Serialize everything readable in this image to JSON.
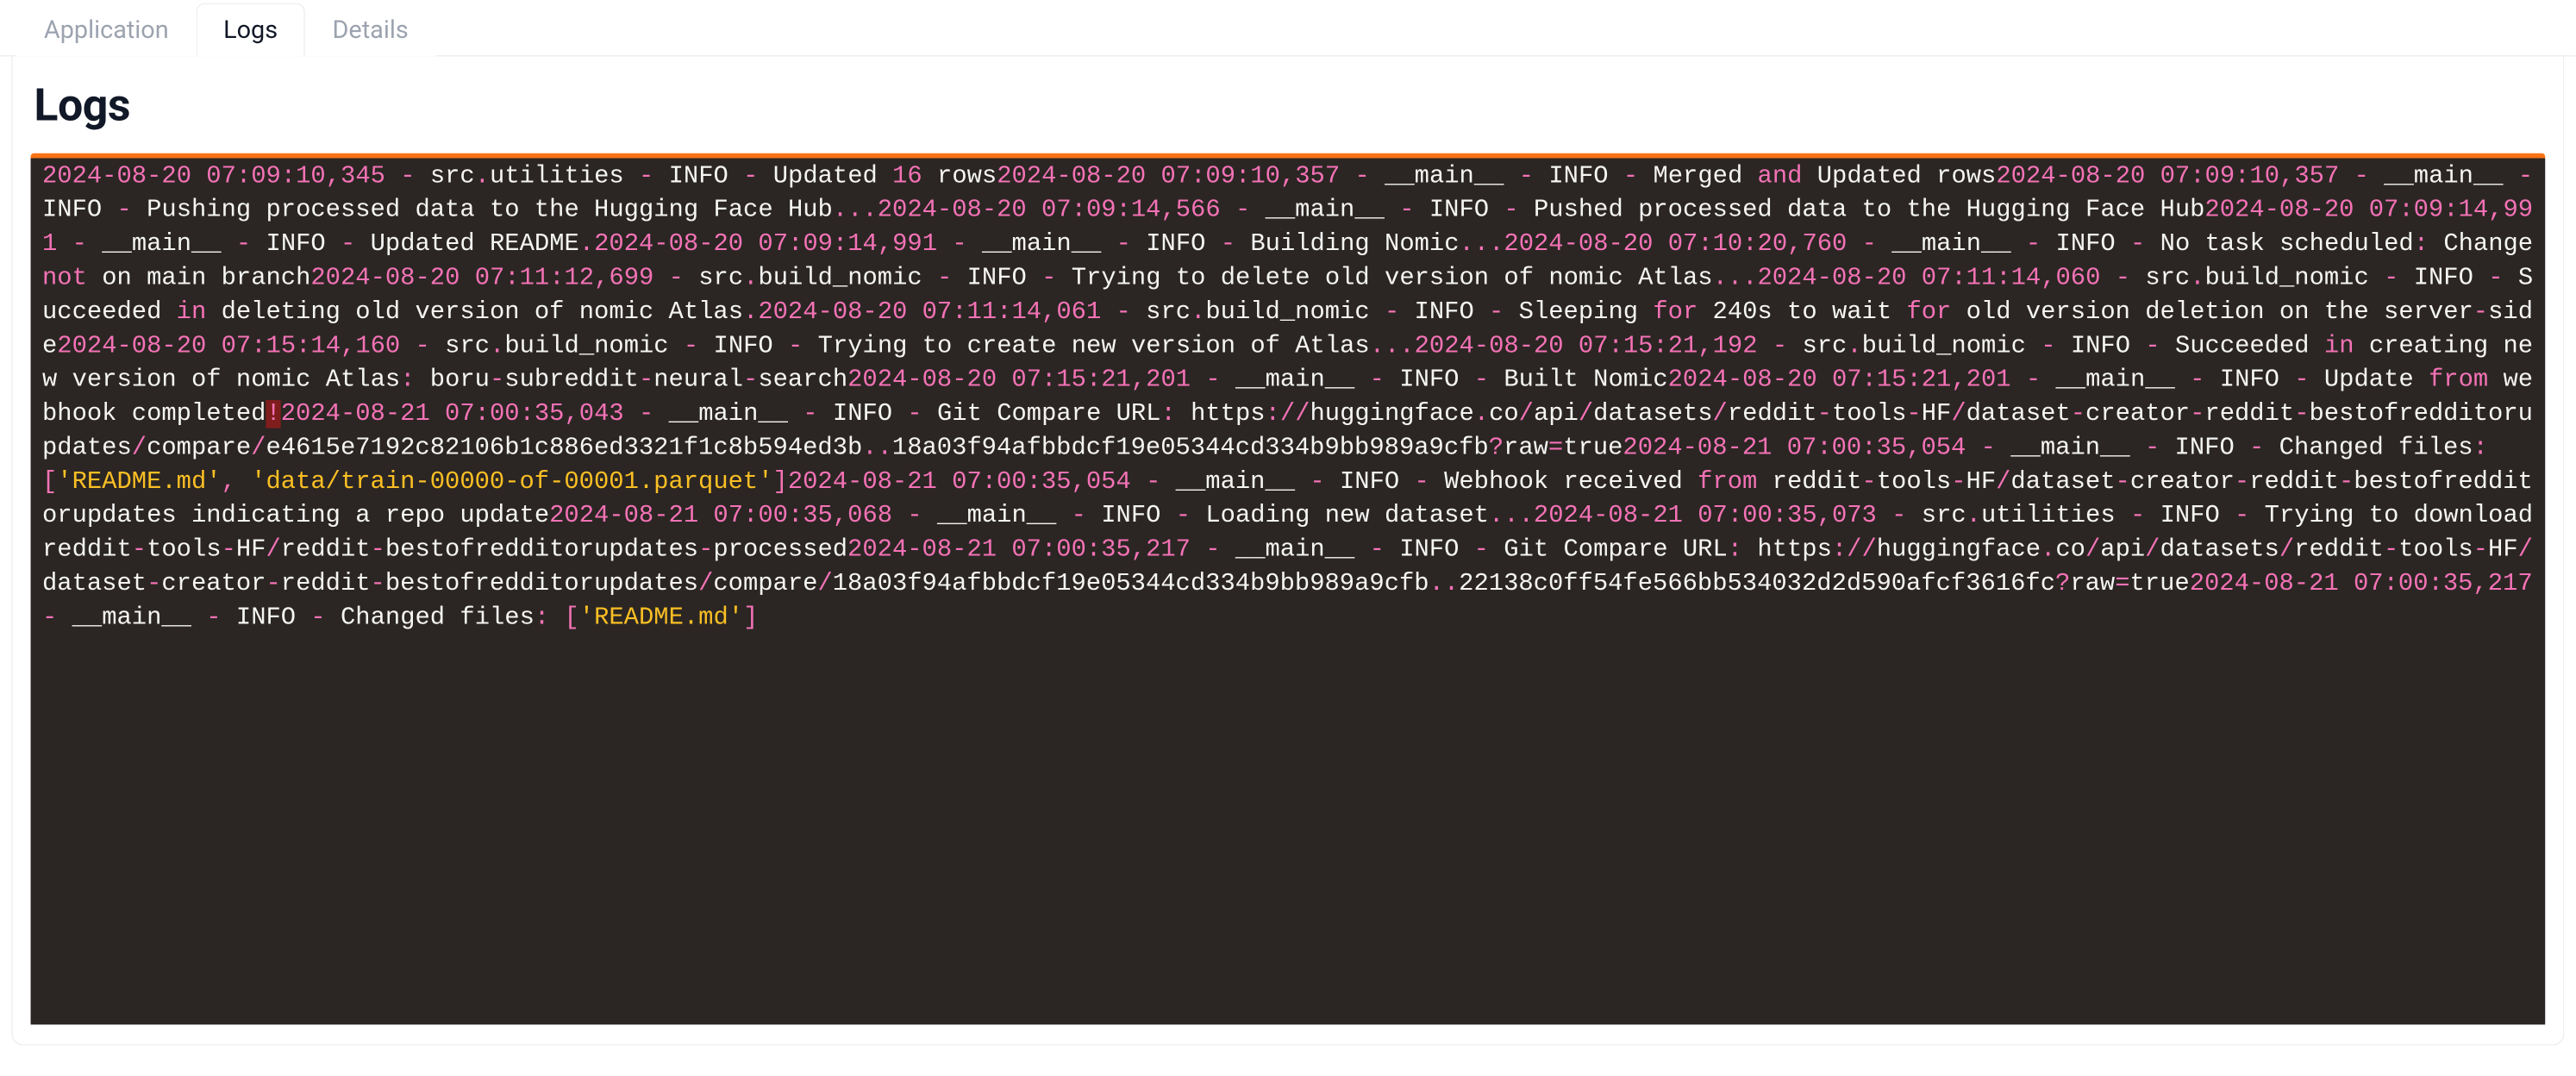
{
  "tabs": {
    "application": "Application",
    "logs": "Logs",
    "details": "Details",
    "active": "logs"
  },
  "panel": {
    "title": "Logs"
  },
  "log": {
    "highlight_keywords": [
      "and",
      "not",
      "in",
      "for",
      "from"
    ],
    "lines": [
      {
        "ts": "2024-08-20 07:09:10,345",
        "mod": "src.utilities",
        "lvl": "INFO",
        "msg": "Updated 16 rows"
      },
      {
        "ts": "2024-08-20 07:09:10,357",
        "mod": "__main__",
        "lvl": "INFO",
        "msg": "Merged and Updated rows"
      },
      {
        "ts": "2024-08-20 07:09:10,357",
        "mod": "__main__",
        "lvl": "INFO",
        "msg": "Pushing processed data to the Hugging Face Hub..."
      },
      {
        "ts": "2024-08-20 07:09:14,566",
        "mod": "__main__",
        "lvl": "INFO",
        "msg": "Pushed processed data to the Hugging Face Hub"
      },
      {
        "ts": "2024-08-20 07:09:14,991",
        "mod": "__main__",
        "lvl": "INFO",
        "msg": "Updated README."
      },
      {
        "ts": "2024-08-20 07:09:14,991",
        "mod": "__main__",
        "lvl": "INFO",
        "msg": "Building Nomic..."
      },
      {
        "ts": "2024-08-20 07:10:20,760",
        "mod": "__main__",
        "lvl": "INFO",
        "msg": "No task scheduled: Change not on main branch"
      },
      {
        "ts": "2024-08-20 07:11:12,699",
        "mod": "src.build_nomic",
        "lvl": "INFO",
        "msg": "Trying to delete old version of nomic Atlas..."
      },
      {
        "ts": "2024-08-20 07:11:14,060",
        "mod": "src.build_nomic",
        "lvl": "INFO",
        "msg": "Succeeded in deleting old version of nomic Atlas."
      },
      {
        "ts": "2024-08-20 07:11:14,061",
        "mod": "src.build_nomic",
        "lvl": "INFO",
        "msg": "Sleeping for 240s to wait for old version deletion on the server-side"
      },
      {
        "ts": "2024-08-20 07:15:14,160",
        "mod": "src.build_nomic",
        "lvl": "INFO",
        "msg": "Trying to create new version of Atlas..."
      },
      {
        "ts": "2024-08-20 07:15:21,192",
        "mod": "src.build_nomic",
        "lvl": "INFO",
        "msg": "Succeeded in creating new version of nomic Atlas: boru-subreddit-neural-search"
      },
      {
        "ts": "2024-08-20 07:15:21,201",
        "mod": "__main__",
        "lvl": "INFO",
        "msg": "Built Nomic"
      },
      {
        "ts": "2024-08-20 07:15:21,201",
        "mod": "__main__",
        "lvl": "INFO",
        "msg": "Update from webhook completed!"
      },
      {
        "ts": "2024-08-21 07:00:35,043",
        "mod": "__main__",
        "lvl": "INFO",
        "msg": "Git Compare URL: https://huggingface.co/api/datasets/reddit-tools-HF/dataset-creator-reddit-bestofredditorupdates/compare/e4615e7192c82106b1c886ed3321f1c8b594ed3b..18a03f94afbbdcf19e05344cd334b9bb989a9cfb?raw=true"
      },
      {
        "ts": "2024-08-21 07:00:35,054",
        "mod": "__main__",
        "lvl": "INFO",
        "msg": "Changed files: ['README.md', 'data/train-00000-of-00001.parquet']"
      },
      {
        "ts": "2024-08-21 07:00:35,054",
        "mod": "__main__",
        "lvl": "INFO",
        "msg": "Webhook received from reddit-tools-HF/dataset-creator-reddit-bestofredditorupdates indicating a repo update"
      },
      {
        "ts": "2024-08-21 07:00:35,068",
        "mod": "__main__",
        "lvl": "INFO",
        "msg": "Loading new dataset..."
      },
      {
        "ts": "2024-08-21 07:00:35,073",
        "mod": "src.utilities",
        "lvl": "INFO",
        "msg": "Trying to download reddit-tools-HF/reddit-bestofredditorupdates-processed"
      },
      {
        "ts": "2024-08-21 07:00:35,217",
        "mod": "__main__",
        "lvl": "INFO",
        "msg": "Git Compare URL: https://huggingface.co/api/datasets/reddit-tools-HF/dataset-creator-reddit-bestofredditorupdates/compare/18a03f94afbbdcf19e05344cd334b9bb989a9cfb..22138c0ff54fe566bb534032d2d590afcf3616fc?raw=true"
      },
      {
        "ts": "2024-08-21 07:00:35,217",
        "mod": "__main__",
        "lvl": "INFO",
        "msg": "Changed files: ['README.md']"
      }
    ]
  }
}
